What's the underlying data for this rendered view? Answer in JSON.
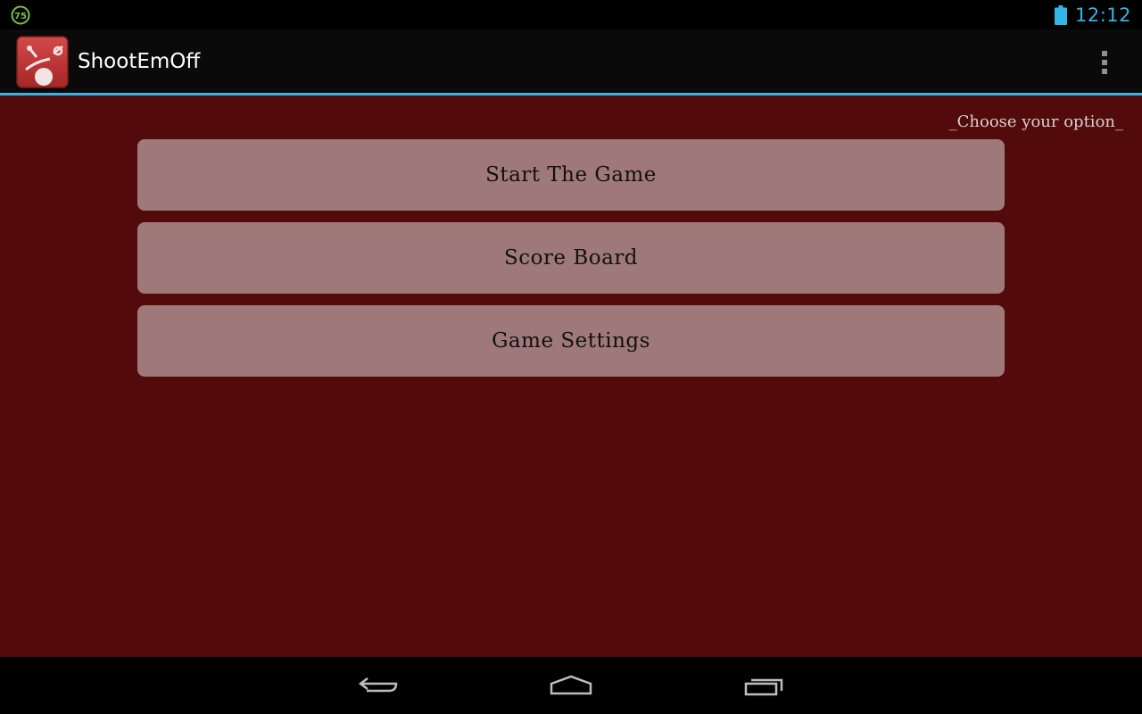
{
  "status_bar": {
    "notification_badge": "75",
    "notification_icon": "notification-75-icon",
    "battery_icon": "battery-icon",
    "time": "12:12",
    "accent_color": "#33b5e5"
  },
  "action_bar": {
    "app_icon": "app-logo-icon",
    "title": "ShootEmOff",
    "overflow_icon": "overflow-menu-icon"
  },
  "main": {
    "background_color": "#520a0b",
    "hint": "_Choose your option_",
    "buttons": [
      {
        "label": "Start The Game"
      },
      {
        "label": "Score Board"
      },
      {
        "label": "Game Settings"
      }
    ],
    "button_color": "#9f787a"
  },
  "nav_bar": {
    "back_icon": "back-icon",
    "home_icon": "home-icon",
    "recents_icon": "recents-icon"
  }
}
